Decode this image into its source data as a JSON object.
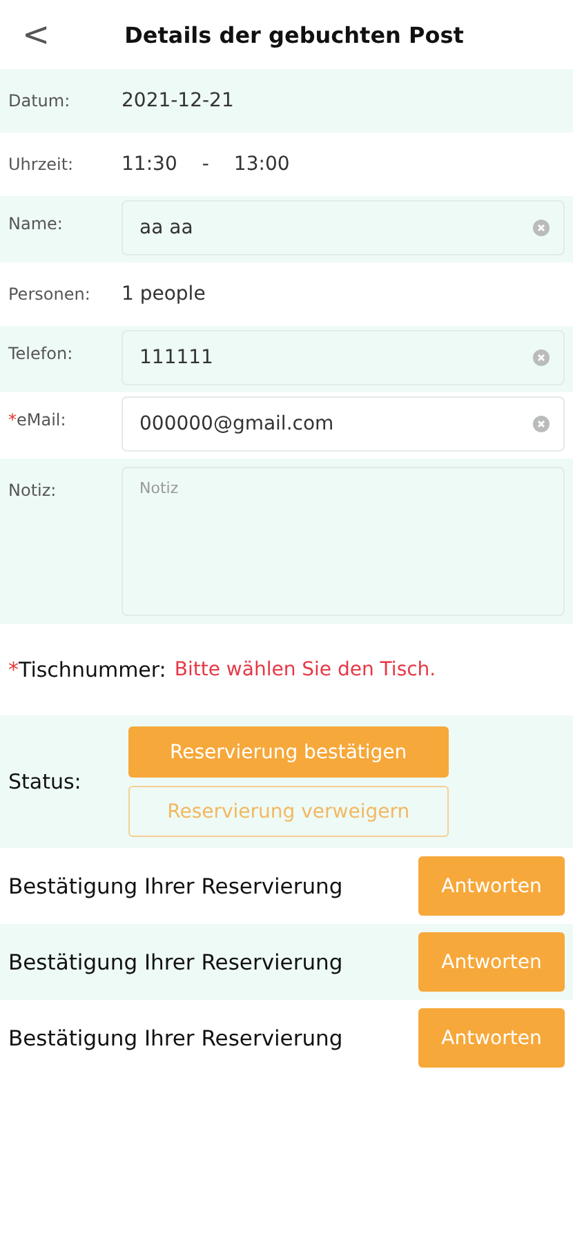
{
  "header": {
    "back": "<",
    "title": "Details der gebuchten Post"
  },
  "fields": [
    {
      "kind": "text",
      "label": "Datum:",
      "values": [
        "2021-12-21"
      ]
    },
    {
      "kind": "text",
      "label": "Uhrzeit:",
      "values": [
        "11:30",
        "-",
        "13:00"
      ]
    },
    {
      "kind": "input",
      "label": "Name:",
      "value": "aa aa"
    },
    {
      "kind": "text",
      "label": "Personen:",
      "values": [
        "1 people"
      ]
    },
    {
      "kind": "input",
      "label": "Telefon:",
      "value": "111111"
    },
    {
      "kind": "input",
      "required_mark": "*",
      "label": "eMail:",
      "value": "000000@gmail.com"
    },
    {
      "kind": "textarea",
      "label": "Notiz:",
      "placeholder": "Notiz"
    }
  ],
  "table": {
    "required_mark": "*",
    "label": "Tischnummer:",
    "hint": "Bitte wählen Sie den Tisch."
  },
  "status": {
    "label": "Status:",
    "options": [
      {
        "label": "Reservierung bestätigen",
        "selected": true
      },
      {
        "label": "Reservierung verweigern",
        "selected": false
      }
    ]
  },
  "replies": [
    {
      "text": "Bestätigung Ihrer Reservierung",
      "button": "Antworten"
    },
    {
      "text": "Bestätigung Ihrer Reservierung",
      "button": "Antworten"
    },
    {
      "text": "Bestätigung Ihrer Reservierung",
      "button": "Antworten"
    }
  ]
}
